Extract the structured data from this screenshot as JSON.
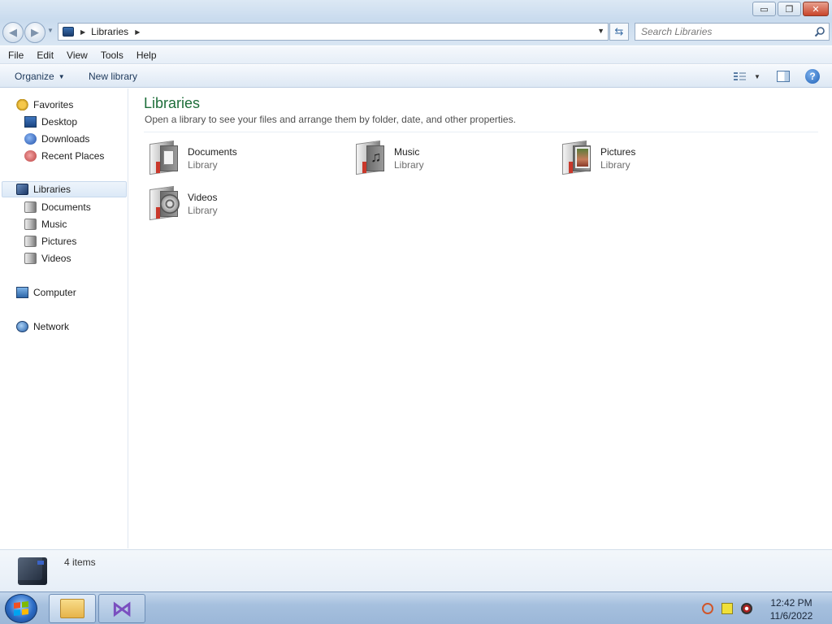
{
  "window": {
    "buttons": {
      "minimize": "▭",
      "maximize": "❐",
      "close": "✕"
    }
  },
  "address": {
    "crumbs": [
      "Libraries"
    ],
    "search_placeholder": "Search Libraries"
  },
  "menu": [
    "File",
    "Edit",
    "View",
    "Tools",
    "Help"
  ],
  "commandbar": {
    "organize_label": "Organize",
    "new_library_label": "New library",
    "help_label": "?"
  },
  "navpane": {
    "favorites_header": "Favorites",
    "favorites": [
      "Desktop",
      "Downloads",
      "Recent Places"
    ],
    "libraries_header": "Libraries",
    "libraries": [
      "Documents",
      "Music",
      "Pictures",
      "Videos"
    ],
    "computer": "Computer",
    "network": "Network"
  },
  "content": {
    "title": "Libraries",
    "subtitle": "Open a library to see your files and arrange them by folder, date, and other properties.",
    "libraries": [
      {
        "name": "Documents",
        "type": "Library",
        "icon": "documents-library-icon"
      },
      {
        "name": "Music",
        "type": "Library",
        "icon": "music-library-icon"
      },
      {
        "name": "Pictures",
        "type": "Library",
        "icon": "pictures-library-icon"
      },
      {
        "name": "Videos",
        "type": "Library",
        "icon": "videos-library-icon"
      }
    ]
  },
  "details": {
    "item_count": "4 items"
  },
  "taskbar": {
    "time": "12:42 PM",
    "date": "11/6/2022",
    "pinned": [
      "windows-explorer",
      "visual-studio"
    ]
  },
  "colors": {
    "title_green": "#1e6e3a",
    "accent_blue": "#1e395b",
    "selection_bg": "#dce9f7"
  }
}
